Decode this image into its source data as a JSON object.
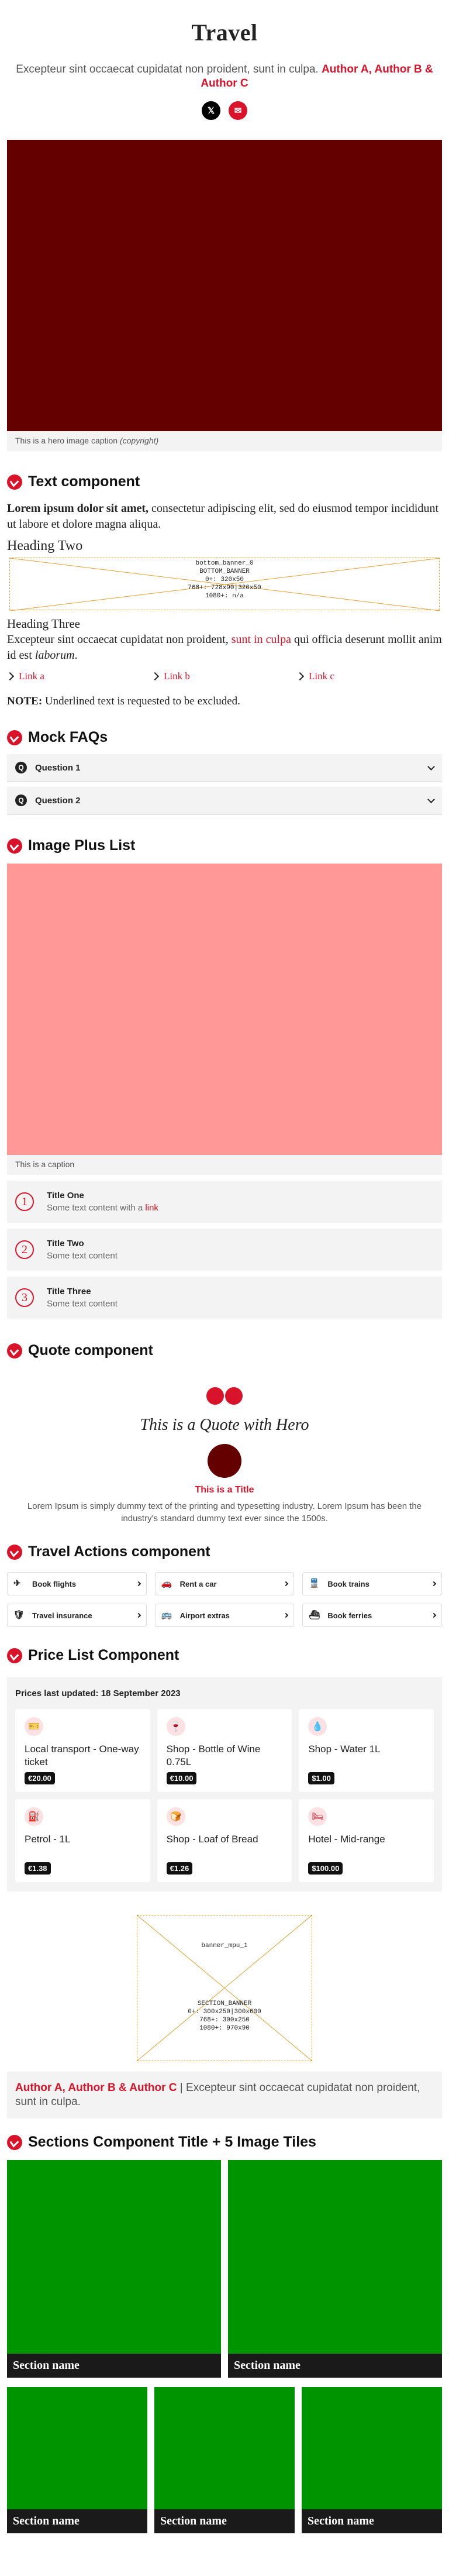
{
  "header": {
    "title": "Travel",
    "standfirst": "Excepteur sint occaecat cupidatat non proident, sunt in culpa.",
    "authors": "Author A, Author B & Author C",
    "share": {
      "twitter_icon": "x-icon",
      "email_icon": "mail-icon"
    },
    "hero_caption": "This is a hero image caption",
    "hero_credit": "(copyright)"
  },
  "text_component": {
    "heading": "Text component",
    "lead_bold": "Lorem ipsum dolor sit amet,",
    "lead_rest": " consectetur adipiscing elit, sed do eiusmod tempor incididunt ut labore et dolore magna aliqua.",
    "heading_two": "Heading Two",
    "banner": {
      "name": "bottom_banner_0",
      "label": "BOTTOM_BANNER",
      "l1": "0+: 320x50",
      "l2": "768+: 728x90|320x50",
      "l3": "1080+: n/a"
    },
    "heading_three": "Heading Three",
    "para_pre": "Excepteur sint occaecat cupidatat non proident, ",
    "para_link": "sunt in culpa",
    "para_mid": " qui officia deserunt mollit anim id est ",
    "para_em": "laborum",
    "para_end": ".",
    "links": [
      "Link a",
      "Link b",
      "Link c"
    ],
    "note_label": "NOTE:",
    "note_text": " Underlined text is requested to be excluded."
  },
  "faqs": {
    "heading": "Mock FAQs",
    "items": [
      "Question 1",
      "Question 2"
    ]
  },
  "image_plus_list": {
    "heading": "Image Plus List",
    "caption": "This is a caption",
    "items": [
      {
        "n": "1",
        "title": "Title One",
        "text": "Some text content with a ",
        "link": "link"
      },
      {
        "n": "2",
        "title": "Title Two",
        "text": "Some text content",
        "link": ""
      },
      {
        "n": "3",
        "title": "Title Three",
        "text": "Some text content",
        "link": ""
      }
    ]
  },
  "quote": {
    "heading": "Quote component",
    "text": "This is a Quote with Hero",
    "title": "This is a Title",
    "body": "Lorem Ipsum is simply dummy text of the printing and typesetting industry. Lorem Ipsum has been the industry's standard dummy text ever since the 1500s."
  },
  "actions": {
    "heading": "Travel Actions component",
    "items": [
      {
        "label": "Book flights",
        "icon": "plane-icon",
        "glyph": "✈"
      },
      {
        "label": "Rent a car",
        "icon": "car-icon",
        "glyph": "🚗"
      },
      {
        "label": "Book trains",
        "icon": "train-icon",
        "glyph": "🚆"
      },
      {
        "label": "Travel insurance",
        "icon": "insurance-icon",
        "glyph": "🛡"
      },
      {
        "label": "Airport extras",
        "icon": "bus-icon",
        "glyph": "🚌"
      },
      {
        "label": "Book ferries",
        "icon": "ferry-icon",
        "glyph": "⛴"
      }
    ]
  },
  "prices": {
    "heading": "Price List Component",
    "updated": "Prices last updated: 18 September 2023",
    "items": [
      {
        "name": "Local transport - One-way ticket",
        "value": "€20.00",
        "icon": "ticket-icon",
        "glyph": "🎫"
      },
      {
        "name": "Shop - Bottle of Wine 0.75L",
        "value": "€10.00",
        "icon": "wine-icon",
        "glyph": "🍷"
      },
      {
        "name": "Shop - Water 1L",
        "value": "$1.00",
        "icon": "water-icon",
        "glyph": "💧"
      },
      {
        "name": "Petrol - 1L",
        "value": "€1.38",
        "icon": "fuel-icon",
        "glyph": "⛽"
      },
      {
        "name": "Shop - Loaf of Bread",
        "value": "€1.26",
        "icon": "bread-icon",
        "glyph": "🍞"
      },
      {
        "name": "Hotel - Mid-range",
        "value": "$100.00",
        "icon": "bed-icon",
        "glyph": "🛏"
      }
    ]
  },
  "mpu": {
    "name": "banner_mpu_1",
    "label": "SECTION_BANNER",
    "l1": "0+: 300x250|300x600",
    "l2": "768+: 300x250",
    "l3": "1080+: 970x90"
  },
  "author_box": {
    "authors": "Author A, Author B & Author C",
    "sep": " | ",
    "text": "Excepteur sint occaecat cupidatat non proident, sunt in culpa."
  },
  "sections": {
    "heading": "Sections Component Title + 5 Image Tiles",
    "tiles": [
      "Section name",
      "Section name",
      "Section name",
      "Section name",
      "Section name"
    ]
  }
}
